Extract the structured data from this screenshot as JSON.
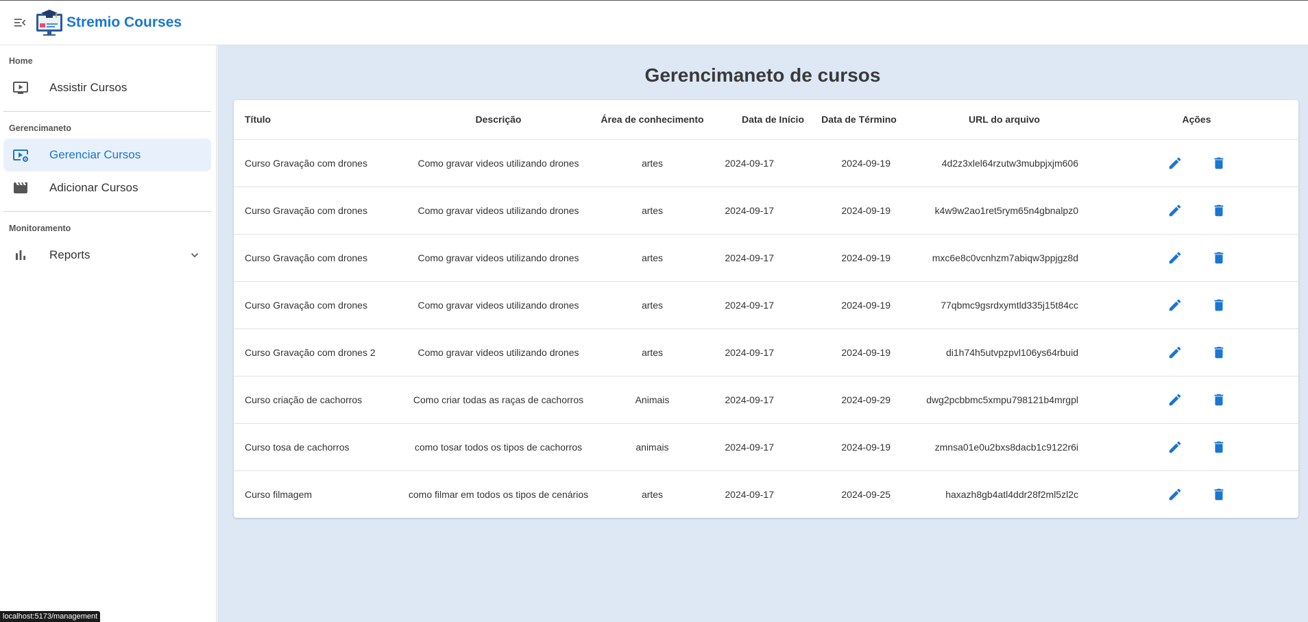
{
  "header": {
    "brand": "Stremio Courses"
  },
  "sidebar": {
    "sections": [
      {
        "title": "Home",
        "items": [
          {
            "label": "Assistir Cursos",
            "icon": "video-play-icon"
          }
        ]
      },
      {
        "title": "Gerencimaneto",
        "items": [
          {
            "label": "Gerenciar Cursos",
            "icon": "video-settings-icon",
            "active": true
          },
          {
            "label": "Adicionar Cursos",
            "icon": "clapperboard-icon"
          }
        ]
      },
      {
        "title": "Monitoramento",
        "items": [
          {
            "label": "Reports",
            "icon": "bar-chart-icon"
          }
        ]
      }
    ]
  },
  "main": {
    "title": "Gerencimaneto de cursos",
    "columns": [
      "Título",
      "Descrição",
      "Área de conhecimento",
      "Data de Início",
      "Data de Término",
      "URL do arquivo",
      "Ações"
    ],
    "rows": [
      [
        "Curso Gravação com drones",
        "Como gravar videos utilizando drones",
        "artes",
        "2024-09-17",
        "2024-09-19",
        "4d2z3xlel64rzutw3mubpjxjm606"
      ],
      [
        "Curso Gravação com drones",
        "Como gravar videos utilizando drones",
        "artes",
        "2024-09-17",
        "2024-09-19",
        "k4w9w2ao1ret5rym65n4gbnalpz0"
      ],
      [
        "Curso Gravação com drones",
        "Como gravar videos utilizando drones",
        "artes",
        "2024-09-17",
        "2024-09-19",
        "mxc6e8c0vcnhzm7abiqw3ppjgz8d"
      ],
      [
        "Curso Gravação com drones",
        "Como gravar videos utilizando drones",
        "artes",
        "2024-09-17",
        "2024-09-19",
        "77qbmc9gsrdxymtld335j15t84cc"
      ],
      [
        "Curso Gravação com drones 2",
        "Como gravar videos utilizando drones",
        "artes",
        "2024-09-17",
        "2024-09-19",
        "di1h74h5utvpzpvl106ys64rbuid"
      ],
      [
        "Curso criação de cachorros",
        "Como criar todas as raças de cachorros",
        "Animais",
        "2024-09-17",
        "2024-09-29",
        "dwg2pcbbmc5xmpu798121b4mrgpl"
      ],
      [
        "Curso tosa de cachorros",
        "como tosar todos os tipos de cachorros",
        "animais",
        "2024-09-17",
        "2024-09-19",
        "zmnsa01e0u2bxs8dacb1c9122r6i"
      ],
      [
        "Curso filmagem",
        "como filmar em todos os tipos de cenários",
        "artes",
        "2024-09-17",
        "2024-09-25",
        "haxazh8gb4atl4ddr28f2ml5zl2c"
      ]
    ]
  },
  "statusbar": {
    "url": "localhost:5173/management"
  },
  "colors": {
    "accent": "#1976d2",
    "content_bg": "#dde8f4",
    "active_bg": "#e8f1fb"
  }
}
